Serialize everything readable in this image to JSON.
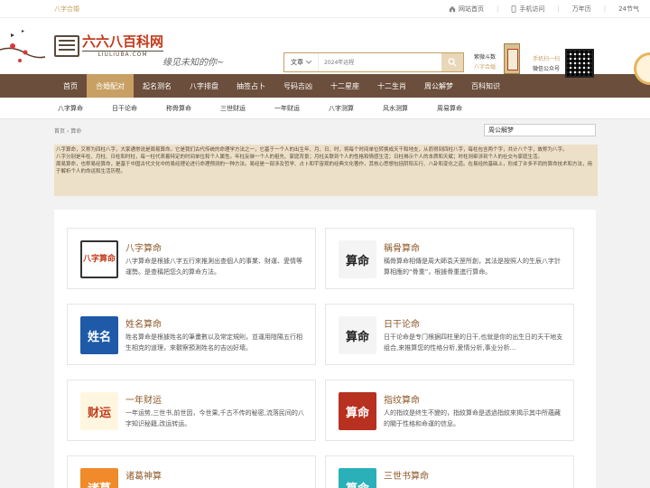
{
  "topbar": {
    "left": "八字合婚",
    "home": "网站首页",
    "mobile": "手机访问",
    "calendar": "万年历",
    "solar_terms": "24节气"
  },
  "header": {
    "logo_cn": "六六八百科网",
    "logo_url": "LIULIUBA.COM",
    "slogan": "缘见未知的你~",
    "search_select": "文章",
    "search_placeholder": "2024年运程",
    "promo1_line1": "紫微斗数",
    "promo1_line2": "八字合婚",
    "promo2_line1": "手机扫一扫",
    "promo2_line2": "微信公众号"
  },
  "nav": {
    "items": [
      "首页",
      "合婚配对",
      "起名测名",
      "八字排盘",
      "抽签占卜",
      "号码吉凶",
      "十二星座",
      "十二生肖",
      "周公解梦",
      "百科知识"
    ],
    "active_index": 1
  },
  "subnav": {
    "items": [
      "八字算命",
      "日干论命",
      "称骨算命",
      "三世财运",
      "一年财运",
      "八字测算",
      "风水测算",
      "周易算命"
    ]
  },
  "breadcrumb": {
    "home": "首页",
    "sep": "›",
    "current": "算命"
  },
  "side_search_value": "周公解梦",
  "intro": {
    "p1": "八字算命，又称为四柱八字，大家通常说是周易算命。它是我们古代传统的命理学方法之一，它基于一个人的出生年、月、日、时，将每个时间单位转换成天干和地支，从而得到四柱八字，每柱包含两个字，共计八个字，故称为八字。",
    "p2": "八字分别是年柱、月柱、日柱和时柱，每一柱代表着特定的时间单位和个人属性。年柱反映一个人的祖先、家庭背景；月柱关联到个人的性格和情感生活；日柱揭示个人的本质和天赋；时柱则牵涉到个人的社交与家庭生活。",
    "p3": "周易算命，也称易经算命，是基于中国古代文化中的易经理论进行命理预测的一种方法。易经是一部涉及哲学、占卜和宇宙观的经典文化著作，其核心思想包括阴阳五行、八卦和变化之道。在易经的基础上，形成了许多不同的算命技术和方法，用于解析个人的命运和生活历程。"
  },
  "cards": [
    {
      "icon": "八字算命",
      "title": "八字算命",
      "desc": "八字算命是根據八字五行來推測出查個人的事業、財運、愛情等運勢。是查稱把您久的算命方法。"
    },
    {
      "icon": "算命",
      "title": "稱骨算命",
      "desc": "稱骨算命相傳是周大師袁天罡所創，其法是按照人的生辰八字計算相應的“骨重”，根據骨重進行算命。"
    },
    {
      "icon": "姓名",
      "title": "姓名算命",
      "desc": "姓名算命是根據姓名的筆畫數以及常定規則，並運用陰陽五行相生相克的道理，來觀察預測姓名的吉凶好壞。"
    },
    {
      "icon": "算命",
      "title": "日干论命",
      "desc": "日干论命是专门根据四柱里的日干,也就是你的出生日的天干地支组合,来推算您的性格分析,爱情分析,事业分析..."
    },
    {
      "icon": "财运",
      "title": "一年财运",
      "desc": "一年运势,三世书,前世因，今世果,千古不传的秘密,流落民间的八字知识秘籍,改运转运。"
    },
    {
      "icon": "算命",
      "title": "指纹算命",
      "desc": "人的指纹是终生不變的，指紋算命是透過指紋來揭示其中所蘊藏的關于性格和命運的信息。"
    },
    {
      "icon": "诸葛",
      "title": "诸葛神算",
      "desc": ""
    },
    {
      "icon": "算命",
      "title": "三世书算命",
      "desc": ""
    }
  ],
  "colors": {
    "nav_bg": "#6b4e3b",
    "nav_active": "#c8a063",
    "card_title": "#8c5a2a",
    "intro_bg": "#ece0c8"
  }
}
